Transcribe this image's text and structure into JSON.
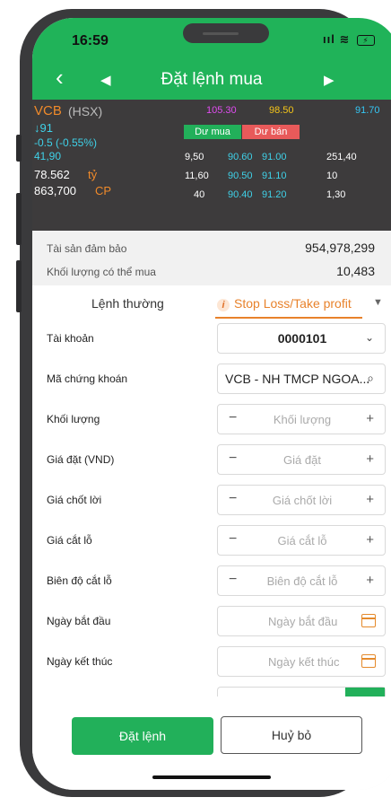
{
  "status": {
    "time": "16:59",
    "signal": "ııl",
    "battery": "⚡"
  },
  "nav": {
    "back_icon": "‹",
    "prev_icon": "◀",
    "title": "Đặt lệnh mua",
    "next_icon": "▶"
  },
  "market": {
    "symbol": "VCB",
    "exchange": "(HSX)",
    "price_ceiling": "105.30",
    "price_ref": "98.50",
    "price_floor": "91.70",
    "last_price": "↓91",
    "change": "-0.5 (-0.55%)",
    "volume_lot": "41,90",
    "value_amount": "78.562",
    "value_unit": "tỷ",
    "total_volume": "863,700",
    "volume_unit": "CP",
    "buy_header": "Dư mua",
    "sell_header": "Dư bán",
    "depth": [
      {
        "bid_vol": "9,50",
        "bid_price": "90.60",
        "ask_price": "91.00",
        "ask_vol": "251,40"
      },
      {
        "bid_vol": "11,60",
        "bid_price": "90.50",
        "ask_price": "91.10",
        "ask_vol": "10"
      },
      {
        "bid_vol": "40",
        "bid_price": "90.40",
        "ask_price": "91.20",
        "ask_vol": "1,30"
      }
    ],
    "colors": {
      "ceiling": "#e04cf0",
      "ref": "#f5c518",
      "floor": "#35c6f4",
      "down": "#3fd1e8",
      "up": "#36d27a",
      "red": "#e85a5a",
      "orange": "#f08a2a"
    }
  },
  "summary": {
    "collateral_label": "Tài sản đảm bảo",
    "collateral_value": "954,978,299",
    "buyable_label": "Khối lượng có thể mua",
    "buyable_value": "10,483"
  },
  "tabs": {
    "normal": "Lệnh thường",
    "stop": "Stop Loss/Take profit",
    "info_icon": "i"
  },
  "form": {
    "account": {
      "label": "Tài khoản",
      "value": "0000101"
    },
    "symbol": {
      "label": "Mã chứng khoán",
      "value": "VCB - NH TMCP NGOA..."
    },
    "quantity": {
      "label": "Khối lượng",
      "placeholder": "Khối lượng"
    },
    "price": {
      "label": "Giá đặt (VND)",
      "placeholder": "Giá đặt"
    },
    "take_profit": {
      "label": "Giá chốt lời",
      "placeholder": "Giá chốt lời"
    },
    "stop_loss": {
      "label": "Giá cắt lỗ",
      "placeholder": "Giá cắt lỗ"
    },
    "stop_range": {
      "label": "Biên độ cắt lỗ",
      "placeholder": "Biên độ cắt lỗ"
    },
    "start_date": {
      "label": "Ngày bắt đầu",
      "placeholder": "Ngày bắt đầu"
    },
    "end_date": {
      "label": "Ngày kết thúc",
      "placeholder": "Ngày kết thúc"
    },
    "minus": "−",
    "plus": "+"
  },
  "actions": {
    "place_order": "Đặt lệnh",
    "cancel": "Huỷ bỏ"
  }
}
